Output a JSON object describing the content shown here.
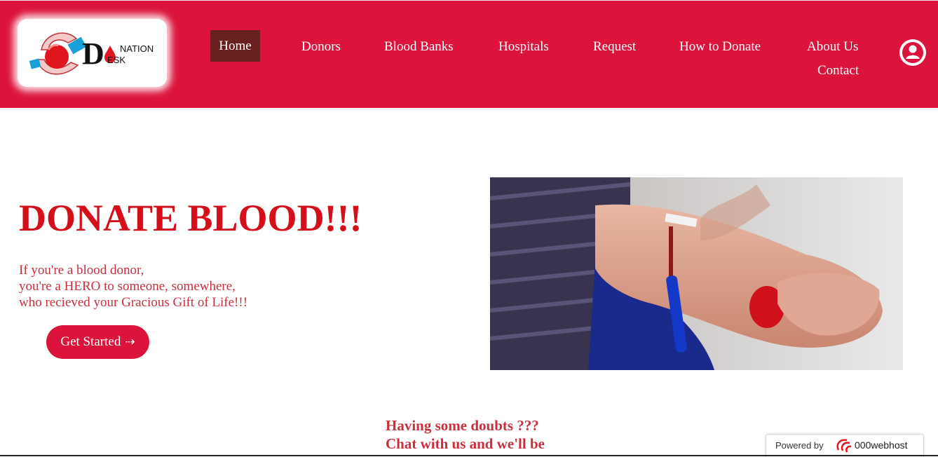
{
  "logo": {
    "word1": "NATION",
    "word2": "ESK",
    "letter": "D"
  },
  "nav": {
    "items": [
      {
        "label": "Home",
        "active": true
      },
      {
        "label": "Donors"
      },
      {
        "label": "Blood Banks"
      },
      {
        "label": "Hospitals"
      },
      {
        "label": "Request"
      },
      {
        "label": "How to Donate"
      },
      {
        "label": "About Us"
      },
      {
        "label": "Contact"
      }
    ],
    "user_icon": "user-circle-icon"
  },
  "hero": {
    "title": "DONATE BLOOD!!!",
    "lines": [
      "If you're a blood donor,",
      "you're a HERO to someone, somewhere,",
      "who recieved your Gracious Gift of Life!!!"
    ],
    "cta_label": "Get Started",
    "cta_icon": "arrow-right-icon"
  },
  "chat": {
    "lines": [
      "Having some doubts ???",
      "Chat with us and we'll be"
    ]
  },
  "badge": {
    "prefix": "Powered by",
    "brand": "000webhost"
  },
  "colors": {
    "primary": "#dc143c",
    "active_nav": "#6b2020",
    "title": "#d40f1b",
    "text": "#c8303c"
  }
}
